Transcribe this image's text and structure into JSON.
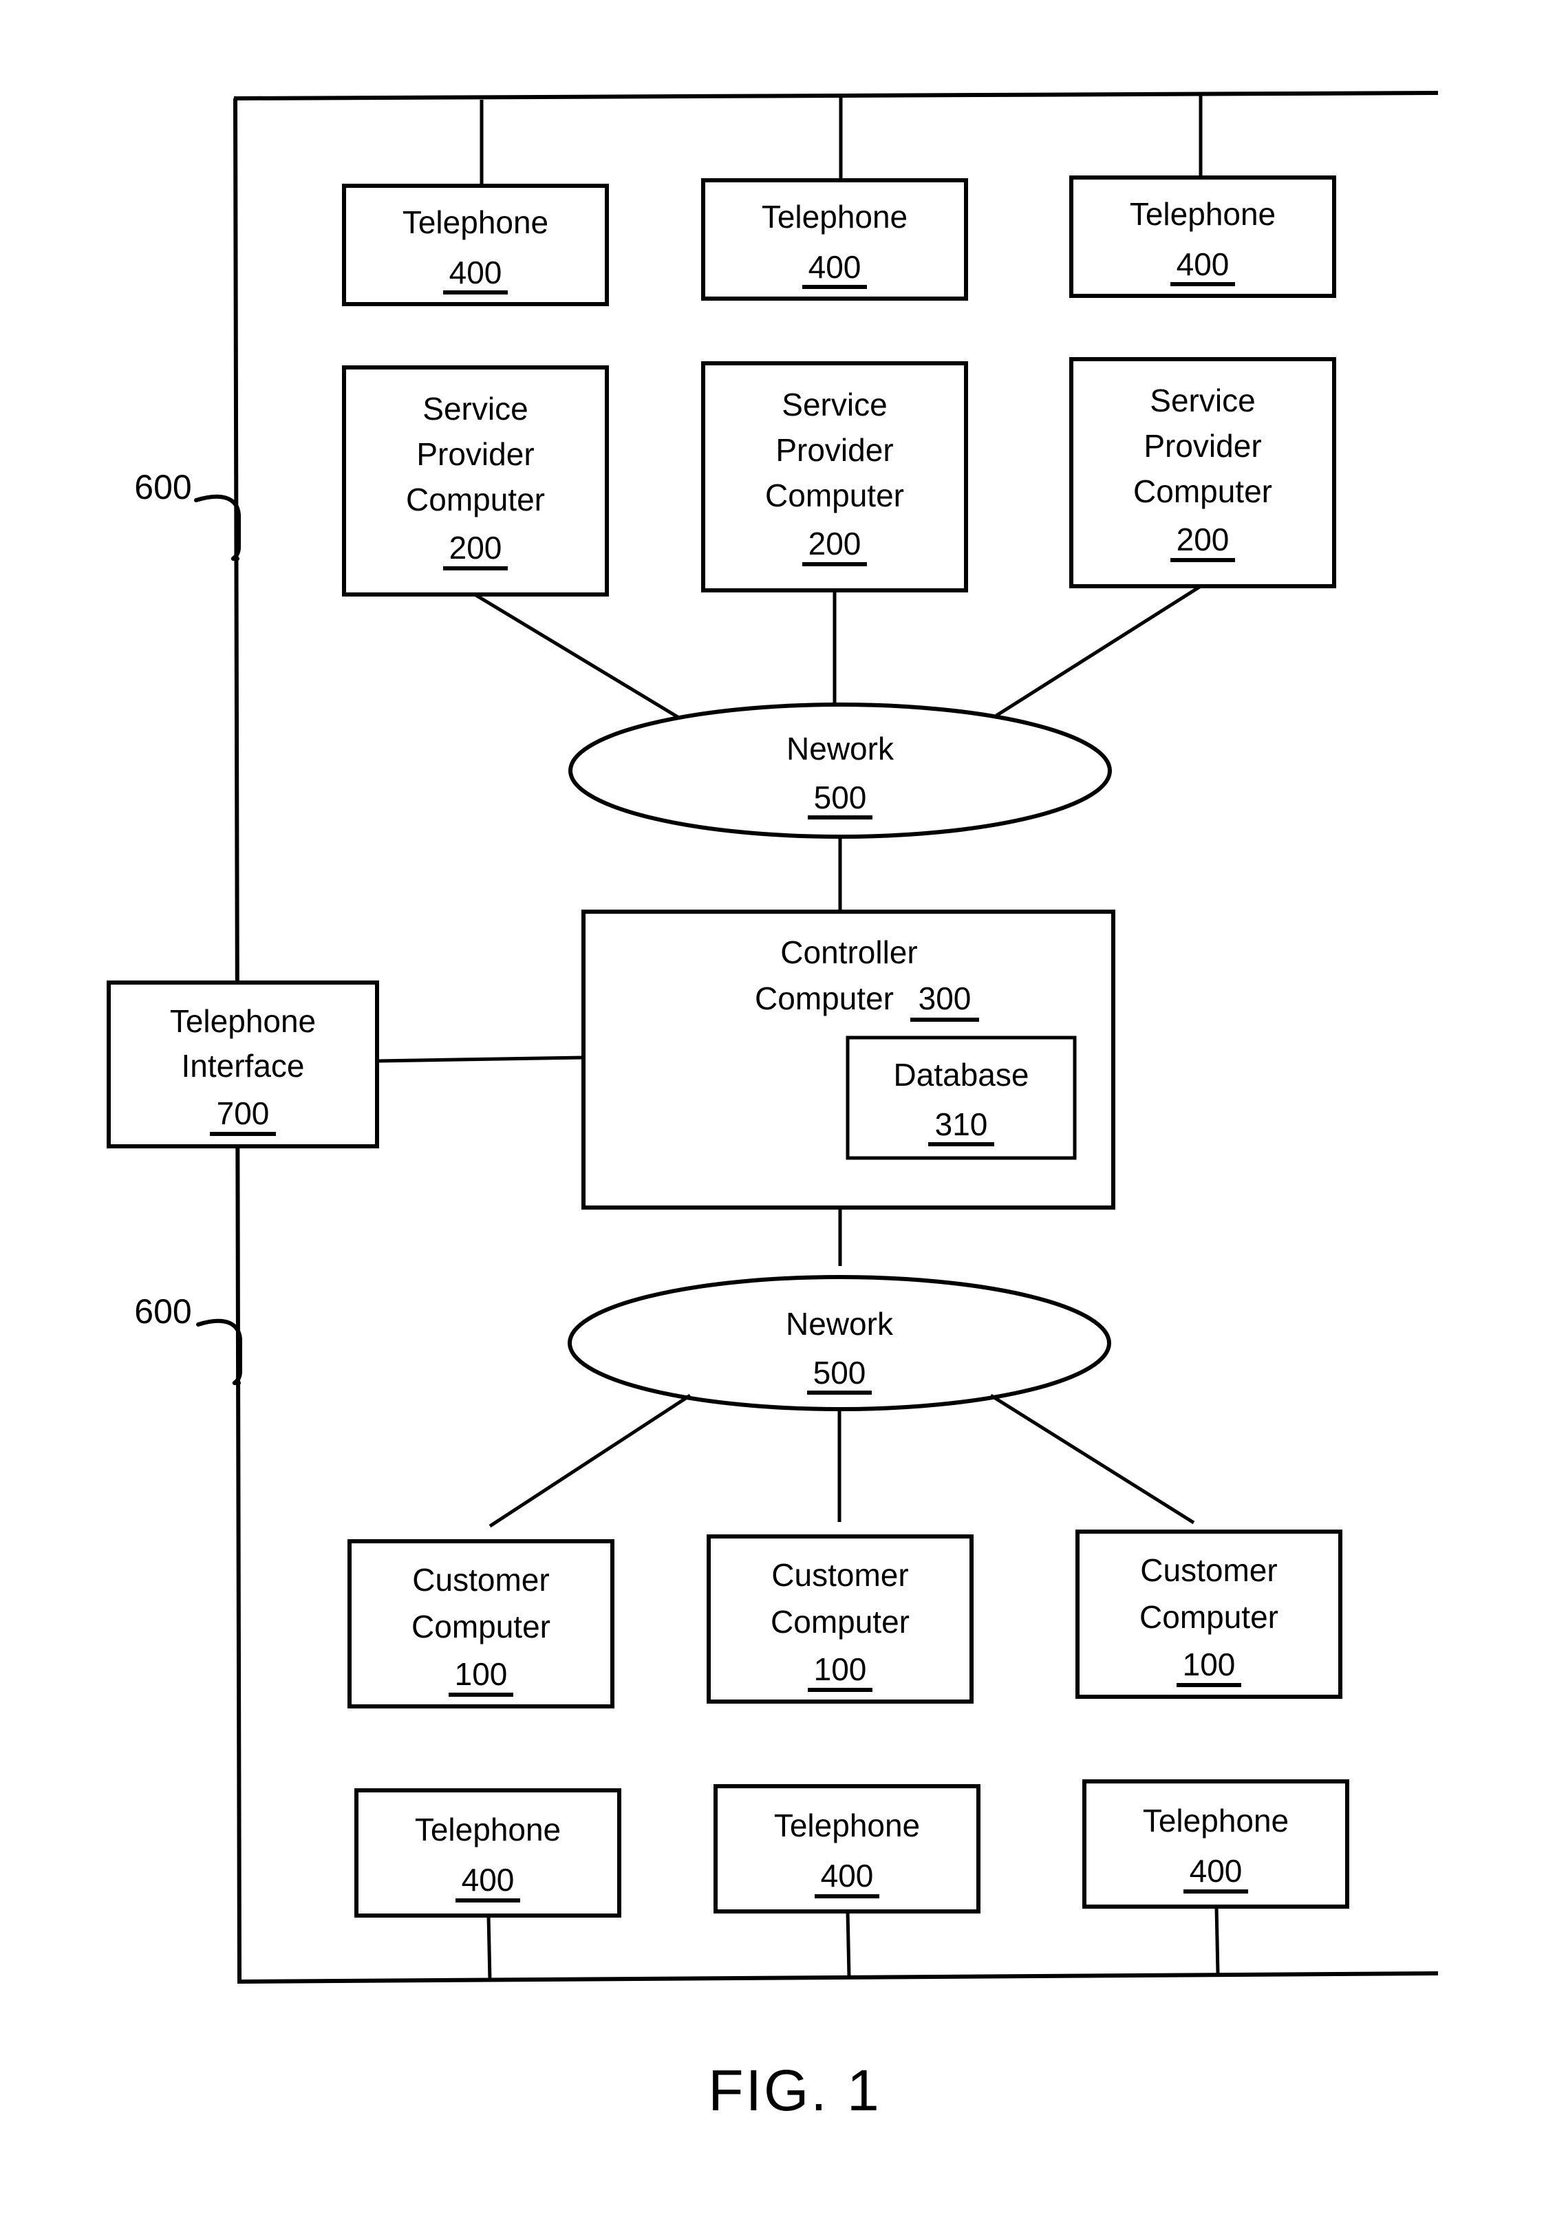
{
  "figure": {
    "caption": "FIG. 1",
    "system_ref_top": "600",
    "system_ref_bottom": "600"
  },
  "nodes": {
    "top_telephones": [
      {
        "label": "Telephone",
        "ref": "400"
      },
      {
        "label": "Telephone",
        "ref": "400"
      },
      {
        "label": "Telephone",
        "ref": "400"
      }
    ],
    "service_providers": [
      {
        "line1": "Service",
        "line2": "Provider",
        "line3": "Computer",
        "ref": "200"
      },
      {
        "line1": "Service",
        "line2": "Provider",
        "line3": "Computer",
        "ref": "200"
      },
      {
        "line1": "Service",
        "line2": "Provider",
        "line3": "Computer",
        "ref": "200"
      }
    ],
    "network_top": {
      "label": "Nework",
      "ref": "500"
    },
    "controller": {
      "line1": "Controller",
      "line2": "Computer",
      "ref": "300",
      "database": {
        "label": "Database",
        "ref": "310"
      }
    },
    "telephone_interface": {
      "line1": "Telephone",
      "line2": "Interface",
      "ref": "700"
    },
    "network_bottom": {
      "label": "Nework",
      "ref": "500"
    },
    "customer_computers": [
      {
        "line1": "Customer",
        "line2": "Computer",
        "ref": "100"
      },
      {
        "line1": "Customer",
        "line2": "Computer",
        "ref": "100"
      },
      {
        "line1": "Customer",
        "line2": "Computer",
        "ref": "100"
      }
    ],
    "bottom_telephones": [
      {
        "label": "Telephone",
        "ref": "400"
      },
      {
        "label": "Telephone",
        "ref": "400"
      },
      {
        "label": "Telephone",
        "ref": "400"
      }
    ]
  }
}
